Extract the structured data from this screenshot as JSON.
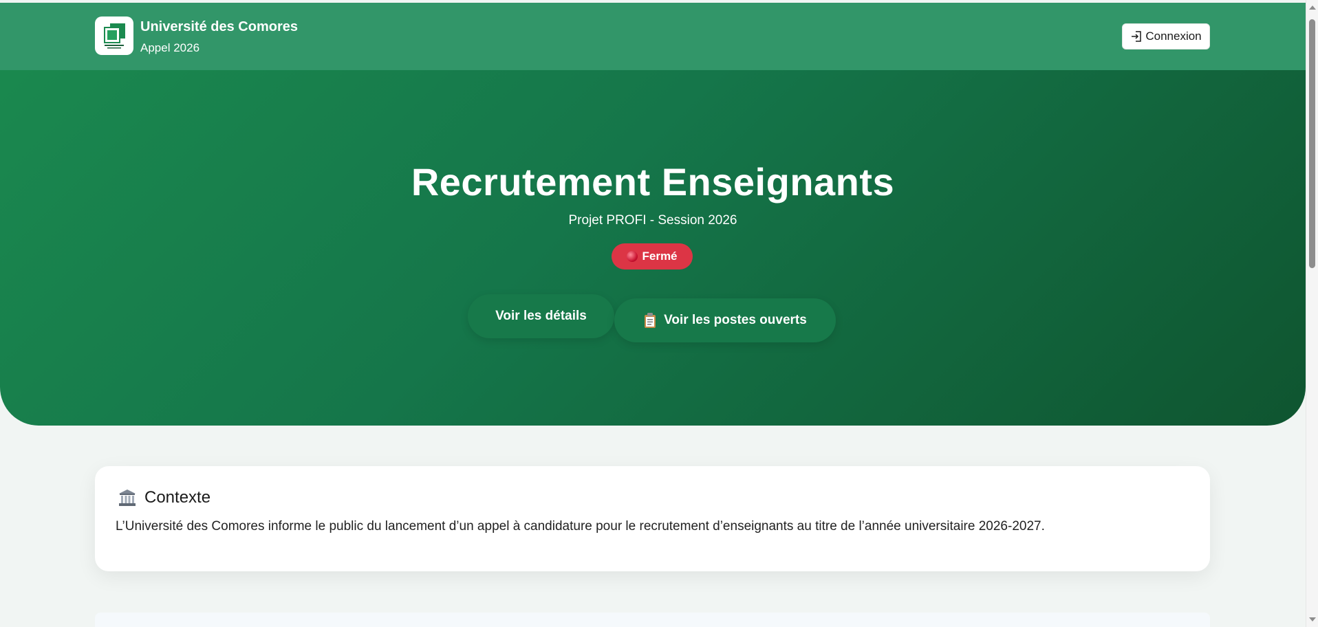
{
  "header": {
    "brand_name": "Université des Comores",
    "brand_subtitle": "Appel 2026",
    "logo_text": "UNIVERSITÉ des Comores",
    "login_label": "Connexion"
  },
  "hero": {
    "title": "Recrutement Enseignants",
    "subtitle": "Projet PROFI - Session 2026",
    "status_label": "Fermé",
    "details_button": "Voir les détails",
    "postes_button": "Voir les postes ouverts"
  },
  "context": {
    "title": "Contexte",
    "text": "L’Université des Comores informe le public du lancement d’un appel à candidature pour le recrutement d’enseignants au titre de l’année universitaire 2026-2027."
  },
  "icons": {
    "logo": "university-logo-icon",
    "login": "login-icon",
    "status": "red-circle-icon",
    "postes": "clipboard-icon",
    "context": "classical-building-icon"
  },
  "colors": {
    "primary": "#1b8a4f",
    "header": "#329669",
    "status_closed": "#dc3545",
    "button": "#17794a"
  }
}
